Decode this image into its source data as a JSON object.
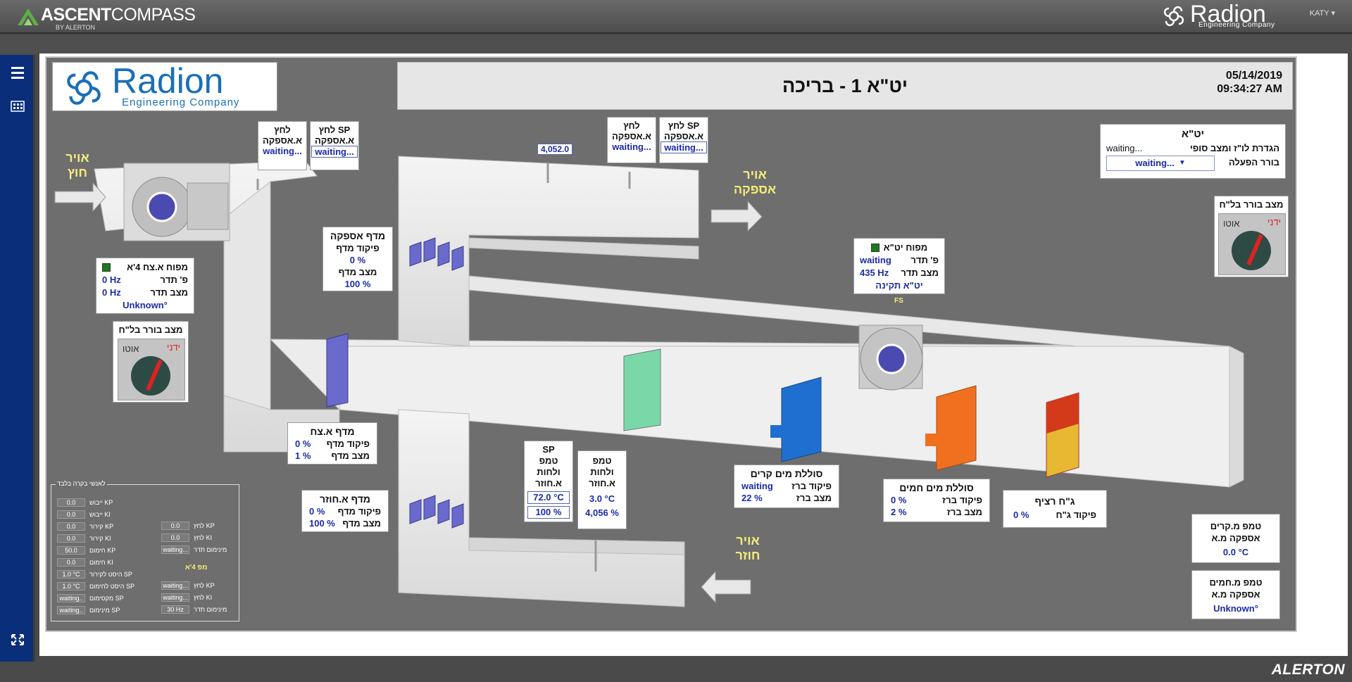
{
  "header": {
    "brand_strong": "ASCENT",
    "brand_light": "COMPASS",
    "brand_by": "BY ALERTON",
    "company_name": "Radion",
    "company_sub": "Engineering Company",
    "user": "KATY ▾"
  },
  "footer": {
    "vendor": "ALERTON"
  },
  "screen": {
    "title": "יט\"א 1 - בריכה",
    "date": "05/14/2019",
    "time": "09:34:27 AM",
    "logo_name": "Radion",
    "logo_sub": "Engineering Company"
  },
  "labels": {
    "outside_air": [
      "אויר",
      "חוץ"
    ],
    "supply_air": [
      "אויר",
      "אספקה"
    ],
    "return_air": [
      "אויר",
      "חוזר"
    ]
  },
  "pressure_fresh": {
    "press_label": [
      "לחץ",
      "א.אספקה"
    ],
    "press_value": "waiting...",
    "sp_label": [
      "SP לחץ",
      "א.אספקה"
    ],
    "sp_value": "waiting..."
  },
  "pressure_supply": {
    "press_label": [
      "לחץ",
      "א.אספקה"
    ],
    "press_value": "waiting...",
    "sp_label": [
      "SP לחץ",
      "א.אספקה"
    ],
    "sp_value": "waiting...",
    "airflow_value": "4,052.0"
  },
  "supply_damper": {
    "title": "מדף אספקה",
    "cmd_label": "פיקוד מדף",
    "cmd_value": "0 %",
    "state_label": "מצב מדף",
    "state_value": "100 %"
  },
  "fresh_fan": {
    "title": "מפוח א.צח 4'א",
    "speed_cmd_label": "פ' תדר",
    "speed_cmd_value": "0 Hz",
    "speed_state_label": "מצב תדר",
    "speed_state_value": "0 Hz",
    "status_value": "Unknown°"
  },
  "fresh_switch": {
    "title": "מצב בורר בל\"ח",
    "manual": "ידני",
    "auto": "אוטו"
  },
  "ahu_switch": {
    "title": "מצב בורר בל\"ח",
    "manual": "ידני",
    "auto": "אוטו"
  },
  "ahu_panel": {
    "title": "יט\"א",
    "schedule_label": "הגדרת לו\"ז ומצב סופי",
    "schedule_value": "waiting...",
    "mode_label": "בורר הפעלה",
    "mode_value": "waiting..."
  },
  "ahu_fan": {
    "title": "מפוח יט\"א",
    "speed_cmd_label": "פ' תדר",
    "speed_cmd_value": "waiting",
    "speed_state_label": "מצב תדר",
    "speed_state_value": "435 Hz",
    "status_value": "יט\"א תקינה",
    "fs_label": "FS"
  },
  "fresh_damper": {
    "title": "מדף א.צח",
    "cmd_label": "פיקוד מדף",
    "cmd_value": "0 %",
    "state_label": "מצב מדף",
    "state_value": "1 %"
  },
  "return_damper": {
    "title": "מדף א.חוזר",
    "cmd_label": "פיקוד מדף",
    "cmd_value": "0 %",
    "state_label": "מצב מדף",
    "state_value": "100 %"
  },
  "return_sp": {
    "label": [
      "SP",
      "טמפ",
      "ולחות",
      "א.חוזר"
    ],
    "temp_value": "72.0 °C",
    "rh_value": "100 %"
  },
  "return_meas": {
    "label": [
      "טמפ",
      "ולחות",
      "א.חוזר"
    ],
    "temp_value": "3.0 °C",
    "rh_value": "4,056 %"
  },
  "cooling_coil": {
    "title": "סוללת מים קרים",
    "cmd_label": "פיקוד ברז",
    "cmd_value": "waiting",
    "state_label": "מצב ברז",
    "state_value": "22 %"
  },
  "heating_coil": {
    "title": "סוללת מים חמים",
    "cmd_label": "פיקוד ברז",
    "cmd_value": "0 %",
    "state_label": "מצב ברז",
    "state_value": "2 %"
  },
  "floor_heater": {
    "title": "ג\"ח רציף",
    "cmd_label": "פיקוד ג\"ח",
    "cmd_value": "0 %"
  },
  "supply_temp_cold": {
    "label": [
      "טמפ מ.קרים",
      "אספקה מ.א"
    ],
    "value": "0.0 °C"
  },
  "supply_temp_hot": {
    "label": [
      "טמפ מ.חמים",
      "אספקה מ.א"
    ],
    "value": "Unknown°"
  },
  "tuning": {
    "legend": "לאנשי בקרה בלבד",
    "left_rows": [
      {
        "label": "KP ייבוש",
        "value": "0.0"
      },
      {
        "label": "KI ייבוש",
        "value": "0.0"
      },
      {
        "label": "KP קירור",
        "value": "0.0"
      },
      {
        "label": "KI קירור",
        "value": "0.0"
      },
      {
        "label": "KP חימום",
        "value": "50.0"
      },
      {
        "label": "KI חימום",
        "value": "0.0"
      },
      {
        "label": "SP היסט לקירור",
        "value": "1.0 °C"
      },
      {
        "label": "SP היסט לחימום",
        "value": "1.0 °C"
      },
      {
        "label": "SP מקסימום",
        "value": "waiting.."
      },
      {
        "label": "SP מינימום",
        "value": "waiting.."
      }
    ],
    "right_rows": [
      {
        "label": "KP לחץ",
        "value": "0.0"
      },
      {
        "label": "KI לחץ",
        "value": "0.0"
      },
      {
        "label": "מינימום תדר",
        "value": "waiting..."
      },
      {
        "label": "KP לחץ",
        "value": "waiting..."
      },
      {
        "label": "KI לחץ",
        "value": "waiting..."
      },
      {
        "label": "מינימום תדר",
        "value": "30 Hz"
      }
    ],
    "right_subtitle": "מפ 4'א"
  },
  "colors": {
    "accent_blue": "#1a2aa8",
    "label_yellow": "#f4ec7a",
    "sidebar": "#0a2e7a",
    "panel": "#6e6e6e",
    "cooling": "#1f6fd1",
    "heating": "#f07020",
    "floor_heat": "#d23a1a",
    "filter": "#7ad7a8"
  },
  "icons": [
    "menu-icon",
    "dashboard-icon",
    "fullscreen-icon",
    "ascent-logo-icon",
    "radion-logo-icon"
  ]
}
